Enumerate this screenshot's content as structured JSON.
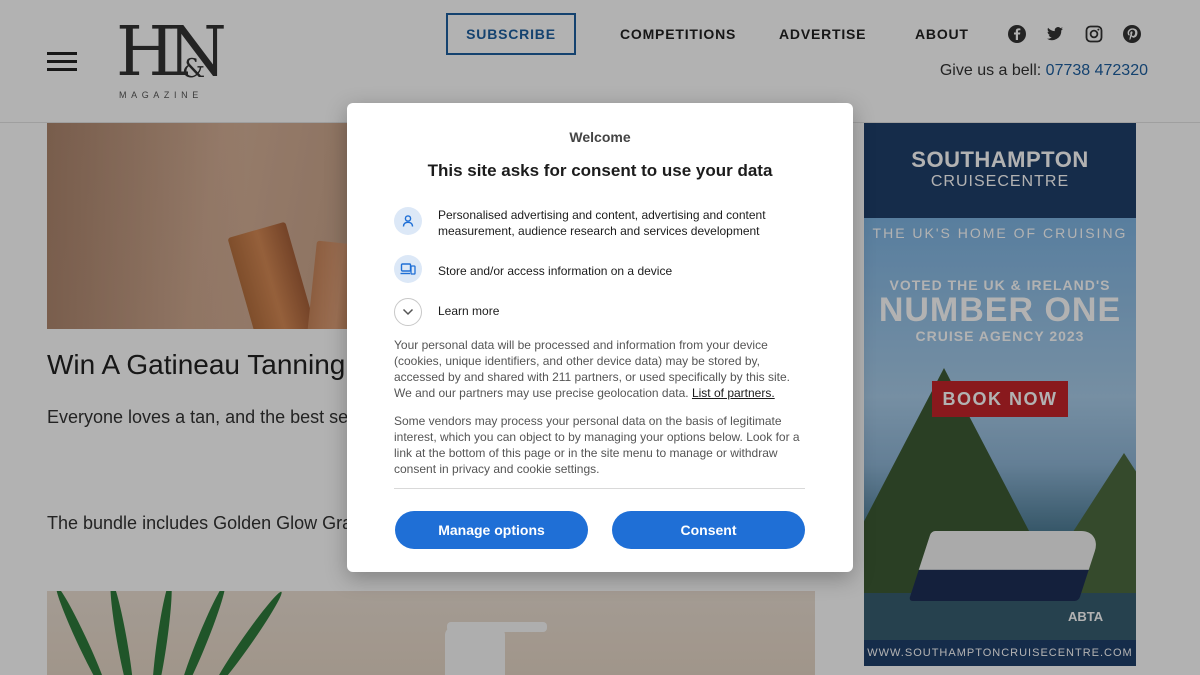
{
  "header": {
    "logo_mark": "HN",
    "logo_amp": "&",
    "logo_sub": "MAGAZINE",
    "subscribe": "SUBSCRIBE",
    "nav": [
      "COMPETITIONS",
      "ADVERTISE",
      "ABOUT"
    ],
    "social_icons": [
      "facebook-icon",
      "twitter-icon",
      "instagram-icon",
      "pinterest-icon"
    ],
    "bell_text": "Give us a bell: ",
    "phone": "07738 472320"
  },
  "article": {
    "title": "Win A Gatineau Tanning",
    "p1": "Everyone loves a tan, and the best sel opinion), are the ones by Gatineau. An away!",
    "p2": "The bundle includes Golden Glow Grad Accelerating Lotion."
  },
  "ad": {
    "brand": "SOUTHAMPTON",
    "brand_sub": "CRUISECENTRE",
    "tagline": "THE UK'S HOME OF CRUISING",
    "voted": "VOTED THE UK & IRELAND'S",
    "number_one": "NUMBER ONE",
    "agency": "CRUISE AGENCY 2023",
    "cta": "BOOK NOW",
    "abta": "ABTA",
    "url": "WWW.SOUTHAMPTONCRUISECENTRE.COM"
  },
  "consent": {
    "welcome": "Welcome",
    "title": "This site asks for consent to use your data",
    "purposes": [
      {
        "icon": "person-icon",
        "text": "Personalised advertising and content, advertising and content measurement, audience research and services development"
      },
      {
        "icon": "devices-icon",
        "text": "Store and/or access information on a device"
      }
    ],
    "learn_more": "Learn more",
    "para1": "Your personal data will be processed and information from your device (cookies, unique identifiers, and other device data) may be stored by, accessed by and shared with 211 partners, or used specifically by this site. We and our partners may use precise geolocation data.",
    "partners_link": "List of partners.",
    "para2": "Some vendors may process your personal data on the basis of legitimate interest, which you can object to by managing your options below. Look for a link at the bottom of this page or in the site menu to manage or withdraw consent in privacy and cookie settings.",
    "manage_label": "Manage options",
    "consent_label": "Consent"
  },
  "colors": {
    "accent_blue": "#1f6fd6",
    "nav_blue": "#1d5fa0",
    "ad_red": "#c4252a",
    "ad_navy": "#1f3f6b"
  }
}
